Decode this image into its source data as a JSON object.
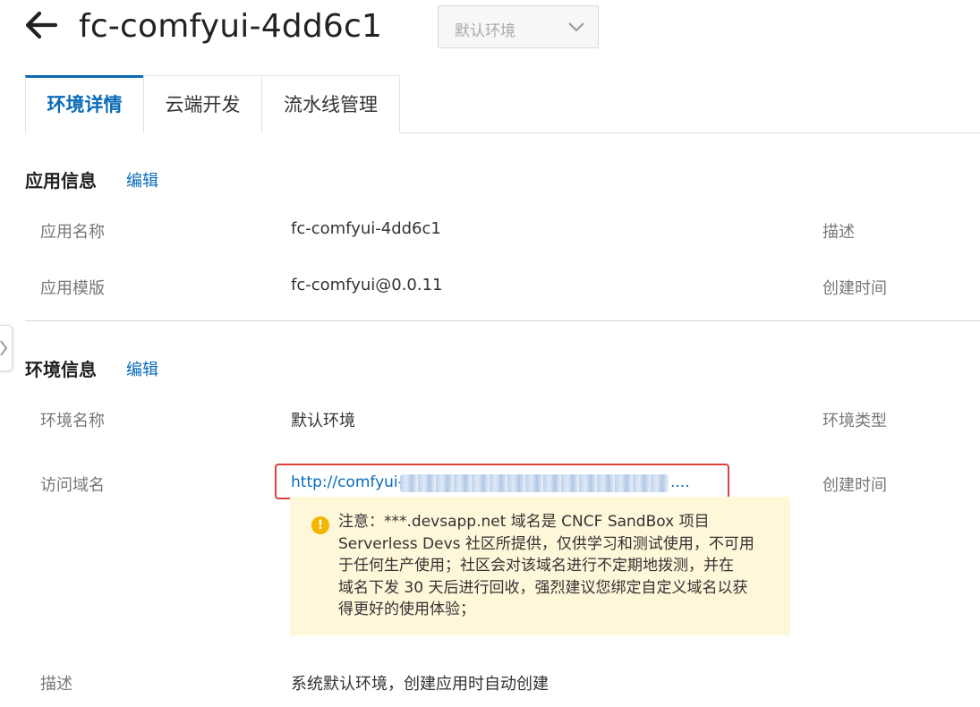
{
  "header": {
    "title": "fc-comfyui-4dd6c1",
    "env_select": "默认环境"
  },
  "tabs": [
    {
      "label": "环境详情",
      "active": true
    },
    {
      "label": "云端开发",
      "active": false
    },
    {
      "label": "流水线管理",
      "active": false
    }
  ],
  "app_info": {
    "title": "应用信息",
    "edit": "编辑",
    "rows": [
      {
        "label": "应用名称",
        "value": "fc-comfyui-4dd6c1",
        "right_label": "描述"
      },
      {
        "label": "应用模版",
        "value": "fc-comfyui@0.0.11",
        "right_label": "创建时间"
      }
    ]
  },
  "env_info": {
    "title": "环境信息",
    "edit": "编辑",
    "env_name_label": "环境名称",
    "env_name_value": "默认环境",
    "env_type_label": "环境类型",
    "domain_label": "访问域名",
    "domain_url_prefix": "http://comfyui-",
    "domain_url_suffix": "....",
    "created_label": "创建时间",
    "notice_lines": [
      "注意：***.devsapp.net 域名是 CNCF SandBox 项目",
      "Serverless Devs 社区所提供，仅供学习和测试使用，不可用",
      "于任何生产使用；社区会对该域名进行不定期地拨测，并在",
      "域名下发 30 天后进行回收，强烈建议您绑定自定义域名以获",
      "得更好的使用体验；"
    ],
    "desc_label": "描述",
    "desc_value": "系统默认环境，创建应用时自动创建"
  },
  "colors": {
    "accent": "#0a6bb8",
    "highlight_border": "#d9443a",
    "notice_bg": "#fff7d9",
    "warn_icon": "#f5b400"
  }
}
